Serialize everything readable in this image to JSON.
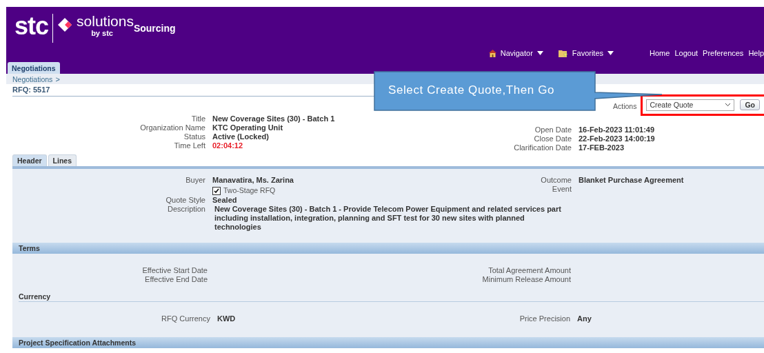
{
  "header": {
    "logo": {
      "brand": "stc",
      "name": "solutions",
      "by": "by stc",
      "app": "Sourcing"
    },
    "nav_menus": [
      {
        "label": "Navigator",
        "kind": "home"
      },
      {
        "label": "Favorites",
        "kind": "folder"
      }
    ],
    "global_links": [
      "Home",
      "Logout",
      "Preferences",
      "Help"
    ],
    "tabs": [
      {
        "label": "Negotiations",
        "selected": true
      }
    ]
  },
  "breadcrumb": {
    "items": [
      "Negotiations"
    ],
    "separator": ">"
  },
  "page_title": "RFQ: 5517",
  "actions": {
    "label": "Actions",
    "value": "Create Quote",
    "button": "Go",
    "highlighted": true
  },
  "callout": {
    "text": "Select Create Quote,Then Go"
  },
  "summary": {
    "left": [
      {
        "label": "Title",
        "value": "New Coverage Sites (30) - Batch 1",
        "alert": false
      },
      {
        "label": "Organization Name",
        "value": "KTC Operating Unit",
        "alert": false
      },
      {
        "label": "Status",
        "value": "Active (Locked)",
        "alert": false
      },
      {
        "label": "Time Left",
        "value": "02:04:12",
        "alert": true
      }
    ],
    "right": [
      {
        "label": "Open Date",
        "value": "16-Feb-2023 11:01:49",
        "alert": false
      },
      {
        "label": "Close Date",
        "value": "22-Feb-2023 14:00:19",
        "alert": false
      },
      {
        "label": "Clarification Date",
        "value": "17-FEB-2023",
        "alert": false
      }
    ]
  },
  "sub_tabs": [
    {
      "label": "Header",
      "selected": true
    },
    {
      "label": "Lines",
      "selected": false
    }
  ],
  "header_section": {
    "left": [
      {
        "kind": "field",
        "label": "Buyer",
        "value": "Manavatira, Ms. Zarina"
      },
      {
        "kind": "checkbox",
        "label": "Two-Stage RFQ",
        "checked": true
      },
      {
        "kind": "field",
        "label": "Quote Style",
        "value": "Sealed"
      },
      {
        "kind": "field",
        "label": "Description",
        "value": "New Coverage Sites (30) - Batch 1 - Provide Telecom Power Equipment and related services part including installation, integration, planning and SFT test for 30 new sites with planned technologies"
      }
    ],
    "right": [
      {
        "kind": "field",
        "label": "Outcome",
        "value": "Blanket Purchase Agreement"
      },
      {
        "kind": "field",
        "label": "Event"
      }
    ]
  },
  "terms": {
    "title": "Terms",
    "left": [
      {
        "kind": "field",
        "label": "Effective Start Date"
      },
      {
        "kind": "field",
        "label": "Effective End Date"
      }
    ],
    "right": [
      {
        "kind": "field",
        "label": "Total Agreement Amount"
      },
      {
        "kind": "field",
        "label": "Minimum Release Amount"
      }
    ]
  },
  "currency": {
    "title": "Currency",
    "left": [
      {
        "kind": "field",
        "label": "RFQ Currency",
        "value": "KWD"
      }
    ],
    "right": [
      {
        "kind": "field",
        "label": "Price Precision",
        "value": "Any"
      }
    ]
  },
  "next_section": {
    "title": "Project Specification Attachments"
  }
}
